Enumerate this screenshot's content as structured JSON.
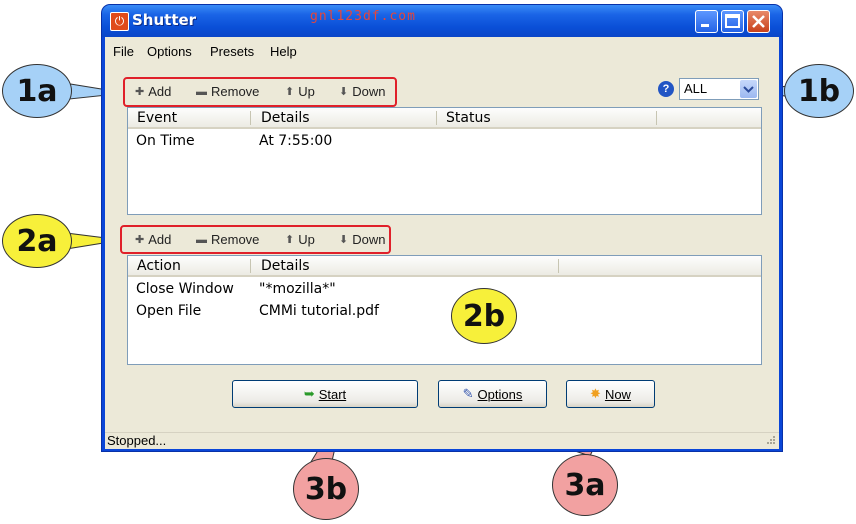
{
  "window": {
    "title": "Shutter",
    "watermark": "gnl123df.com",
    "app_icon": "power-icon"
  },
  "menu": [
    "File",
    "Options",
    "Presets",
    "Help"
  ],
  "events_toolbar": {
    "add": "Add",
    "remove": "Remove",
    "up": "Up",
    "down": "Down"
  },
  "filter": {
    "value": "ALL"
  },
  "events_list": {
    "columns": [
      "Event",
      "Details",
      "Status"
    ],
    "rows": [
      {
        "event": "On Time",
        "details": "At 7:55:00",
        "status": ""
      }
    ]
  },
  "actions_toolbar": {
    "add": "Add",
    "remove": "Remove",
    "up": "Up",
    "down": "Down"
  },
  "actions_list": {
    "columns": [
      "Action",
      "Details"
    ],
    "rows": [
      {
        "action": "Close Window",
        "details": "\"*mozilla*\""
      },
      {
        "action": "Open File",
        "details": "CMMi tutorial.pdf"
      }
    ]
  },
  "buttons": {
    "start": "Start",
    "options": "Options",
    "now": "Now"
  },
  "status": "Stopped...",
  "annotations": {
    "a1a": "1a",
    "a1b": "1b",
    "a2a": "2a",
    "a2b": "2b",
    "a3a": "3a",
    "a3b": "3b",
    "blue": "#a6d1f7",
    "yellow": "#f7f03a",
    "pink": "#f2a1a1",
    "red_box": "#e0202a"
  }
}
